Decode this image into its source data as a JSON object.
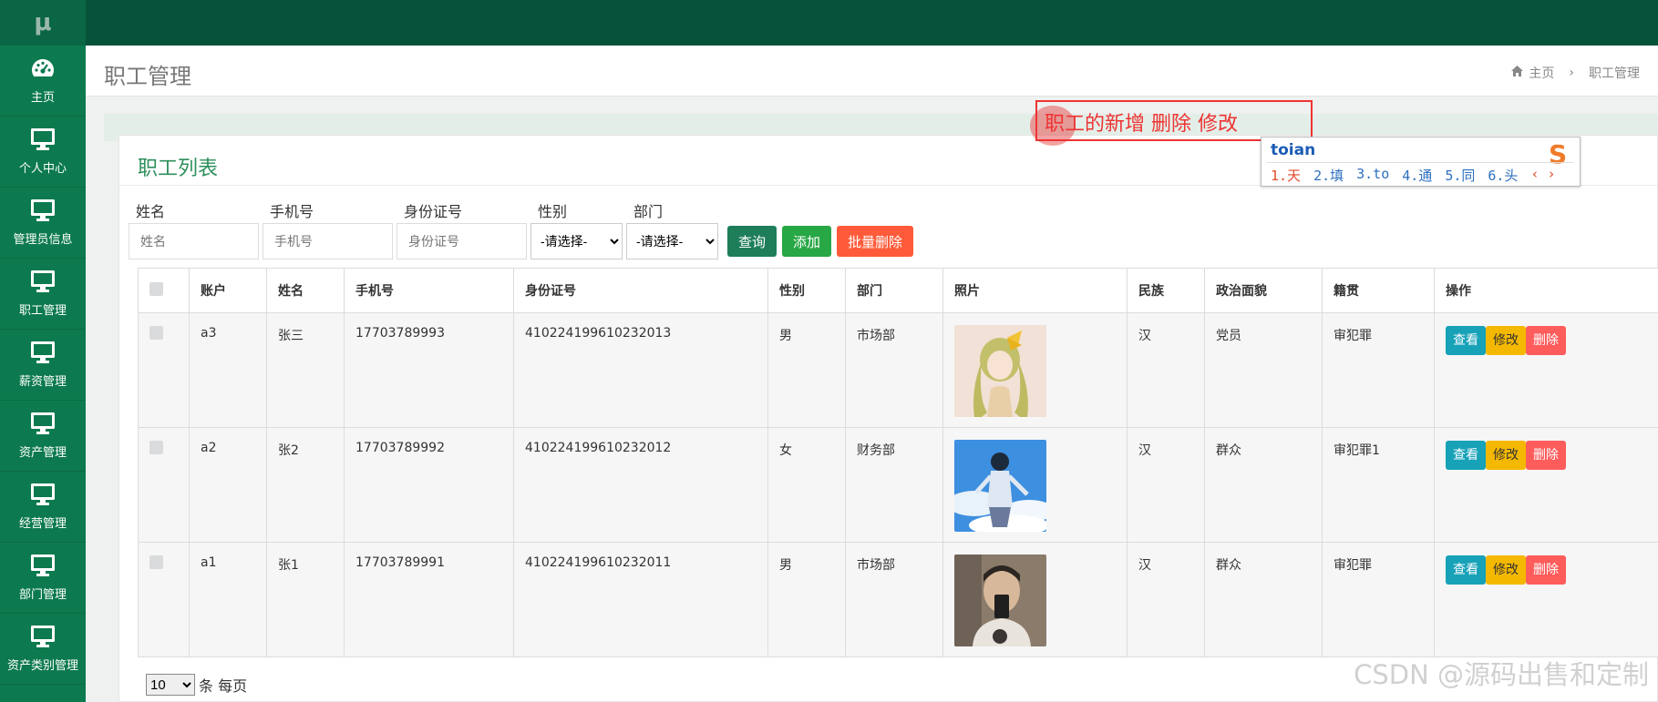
{
  "app": {
    "logo_text": "μ"
  },
  "sidebar": {
    "items": [
      {
        "label": "主页",
        "icon": "dashboard-icon"
      },
      {
        "label": "个人中心",
        "icon": "monitor-icon"
      },
      {
        "label": "管理员信息",
        "icon": "monitor-icon"
      },
      {
        "label": "职工管理",
        "icon": "monitor-icon"
      },
      {
        "label": "薪资管理",
        "icon": "monitor-icon"
      },
      {
        "label": "资产管理",
        "icon": "monitor-icon"
      },
      {
        "label": "经营管理",
        "icon": "monitor-icon"
      },
      {
        "label": "部门管理",
        "icon": "monitor-icon"
      },
      {
        "label": "资产类别管理",
        "icon": "monitor-icon"
      }
    ]
  },
  "header": {
    "title": "职工管理",
    "breadcrumb": {
      "home": "主页",
      "separator": "›",
      "current": "职工管理"
    }
  },
  "card": {
    "title": "职工列表"
  },
  "filters": {
    "name": {
      "label": "姓名",
      "placeholder": "姓名"
    },
    "phone": {
      "label": "手机号",
      "placeholder": "手机号"
    },
    "idcard": {
      "label": "身份证号",
      "placeholder": "身份证号"
    },
    "gender": {
      "label": "性别",
      "selected": "-请选择-"
    },
    "dept": {
      "label": "部门",
      "selected": "-请选择-"
    },
    "query_label": "查询",
    "add_label": "添加",
    "batch_delete_label": "批量删除"
  },
  "table": {
    "columns": [
      "账户",
      "姓名",
      "手机号",
      "身份证号",
      "性别",
      "部门",
      "照片",
      "民族",
      "政治面貌",
      "籍贯",
      "操作"
    ],
    "rows": [
      {
        "account": "a3",
        "name": "张三",
        "phone": "17703789993",
        "idcard": "410224199610232013",
        "gender": "男",
        "dept": "市场部",
        "ethnicity": "汉",
        "political": "党员",
        "native": "审犯罪"
      },
      {
        "account": "a2",
        "name": "张2",
        "phone": "17703789992",
        "idcard": "410224199610232012",
        "gender": "女",
        "dept": "财务部",
        "ethnicity": "汉",
        "political": "群众",
        "native": "审犯罪1"
      },
      {
        "account": "a1",
        "name": "张1",
        "phone": "17703789991",
        "idcard": "410224199610232011",
        "gender": "男",
        "dept": "市场部",
        "ethnicity": "汉",
        "political": "群众",
        "native": "审犯罪"
      }
    ],
    "actions": {
      "view": "查看",
      "edit": "修改",
      "delete": "删除"
    }
  },
  "pagination": {
    "page_size": "10",
    "suffix": "条 每页"
  },
  "annotation": {
    "text": "职工的新增  删除 修改"
  },
  "ime": {
    "input": "toian",
    "candidates": [
      "1.天",
      "2.填",
      "3.to",
      "4.通",
      "5.同",
      "6.头"
    ],
    "nav": "‹ ›"
  },
  "watermark": "CSDN @源码出售和定制",
  "colors": {
    "sidebar": "#0c7a4e",
    "topbar": "#07523a",
    "query": "#1e7e5a",
    "add": "#28a745",
    "batch_delete": "#ff5b3a",
    "view": "#17a2b8",
    "edit": "#f5b800",
    "delete": "#ff5c5c"
  }
}
